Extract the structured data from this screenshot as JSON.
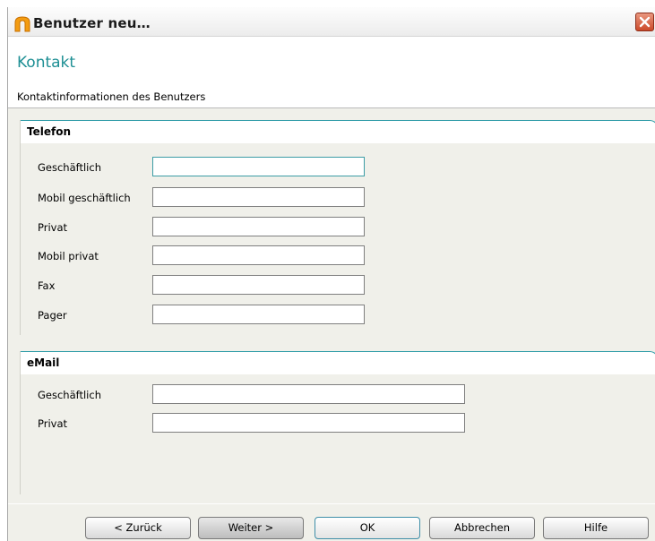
{
  "window": {
    "title": "Benutzer neu…",
    "close_icon": "close-x-icon"
  },
  "header": {
    "title": "Kontakt",
    "subtitle": "Kontaktinformationen des Benutzers",
    "accent_color": "#1e8f94"
  },
  "telefon": {
    "title": "Telefon",
    "fields": [
      {
        "label": "Geschäftlich",
        "value": ""
      },
      {
        "label": "Mobil geschäftlich",
        "value": ""
      },
      {
        "label": "Privat",
        "value": ""
      },
      {
        "label": "Mobil privat",
        "value": ""
      },
      {
        "label": "Fax",
        "value": ""
      },
      {
        "label": "Pager",
        "value": ""
      }
    ]
  },
  "email": {
    "title": "eMail",
    "fields": [
      {
        "label": "Geschäftlich",
        "value": ""
      },
      {
        "label": "Privat",
        "value": ""
      }
    ]
  },
  "buttons": {
    "back": "< Zurück",
    "next": "Weiter >",
    "ok": "OK",
    "cancel": "Abbrechen",
    "help": "Hilfe"
  }
}
